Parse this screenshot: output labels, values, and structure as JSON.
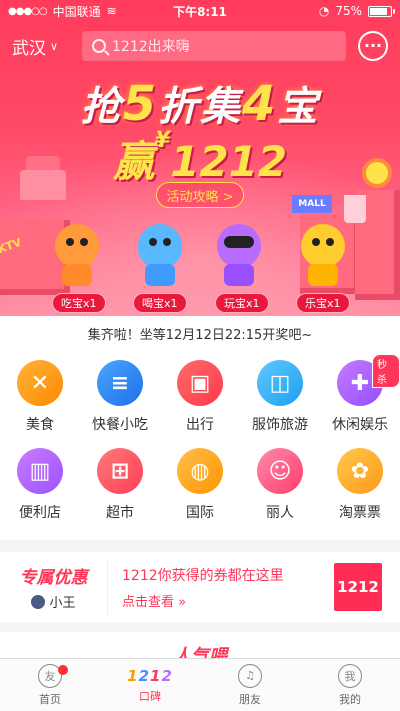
{
  "status_bar": {
    "carrier": "中国联通",
    "time": "下午8:11",
    "battery": "75%"
  },
  "header": {
    "city": "武汉",
    "search_placeholder": "1212出来嗨"
  },
  "hero": {
    "headline_pre": "抢",
    "headline_num1": "5",
    "headline_mid": "折集",
    "headline_num2": "4",
    "headline_post": "宝",
    "headline2_pre": "赢",
    "headline2_yen": "¥",
    "headline2_num": "1212",
    "strategy_button": "活动攻略 >",
    "ktv": "KTV",
    "mall": "MALL",
    "tags": [
      "吃宝x1",
      "喝宝x1",
      "玩宝x1",
      "乐宝x1"
    ]
  },
  "notice": "集齐啦！坐等12月12日22:15开奖吧~",
  "categories": [
    {
      "label": "美食",
      "icon": "fork-spoon-icon",
      "glyph": "✕"
    },
    {
      "label": "快餐小吃",
      "icon": "burger-icon",
      "glyph": "≡"
    },
    {
      "label": "出行",
      "icon": "car-icon",
      "glyph": "▣"
    },
    {
      "label": "服饰旅游",
      "icon": "shopping-bag-icon",
      "glyph": "◫"
    },
    {
      "label": "休闲娱乐",
      "icon": "gamepad-icon",
      "glyph": "✚",
      "badge": "秒杀"
    },
    {
      "label": "便利店",
      "icon": "storefront-icon",
      "glyph": "▥"
    },
    {
      "label": "超市",
      "icon": "basket-icon",
      "glyph": "⊞"
    },
    {
      "label": "国际",
      "icon": "planet-icon",
      "glyph": "◍"
    },
    {
      "label": "丽人",
      "icon": "woman-icon",
      "glyph": "☺"
    },
    {
      "label": "淘票票",
      "icon": "film-reel-icon",
      "glyph": "✿"
    }
  ],
  "coupon": {
    "title": "专属优惠",
    "user": "小王",
    "text": "1212你获得的券都在这里",
    "link": "点击查看 »",
    "logo": "1212"
  },
  "popular": {
    "title": "人气喂"
  },
  "tabbar": [
    {
      "label": "首页",
      "icon": "home-icon",
      "glyph": "友"
    },
    {
      "label": "口碑",
      "icon": "1212-icon",
      "glyph": "1212"
    },
    {
      "label": "朋友",
      "icon": "friends-icon",
      "glyph": "♫"
    },
    {
      "label": "我的",
      "icon": "profile-icon",
      "glyph": "我"
    }
  ],
  "colors": {
    "accent": "#ff3658",
    "hero_top": "#ff3b5c",
    "highlight": "#ffe34a"
  }
}
